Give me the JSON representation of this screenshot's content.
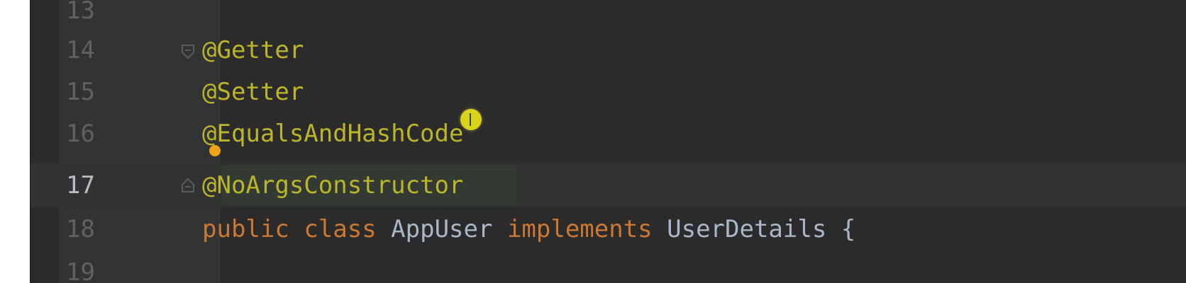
{
  "editor": {
    "lines": [
      {
        "number": "13",
        "code": ""
      },
      {
        "number": "14",
        "code": "@Getter"
      },
      {
        "number": "15",
        "code": "@Setter"
      },
      {
        "number": "16",
        "code": "@EqualsAndHashCode"
      },
      {
        "number": "17",
        "code": "@NoArgsConstructor"
      },
      {
        "number": "18",
        "code": "public class AppUser implements UserDetails {"
      },
      {
        "number": "19",
        "code": ""
      }
    ],
    "line18_tokens": {
      "public": "public",
      "class": "class",
      "name": "AppUser",
      "implements": "implements",
      "iface": "UserDetails",
      "brace": "{"
    },
    "current_line": "17",
    "colors": {
      "background": "#2b2b2b",
      "gutter": "#313335",
      "annotation": "#bbb529",
      "keyword": "#cc7832",
      "identifier": "#a9b7c6",
      "line_number": "#5f6165",
      "cursor_marker": "#d9d21a",
      "intention_bulb": "#f1a317"
    },
    "icons": {
      "fold_marker": "fold-toggle-icon",
      "mouse_cursor": "text-cursor-icon",
      "intention": "lightbulb-icon"
    }
  }
}
